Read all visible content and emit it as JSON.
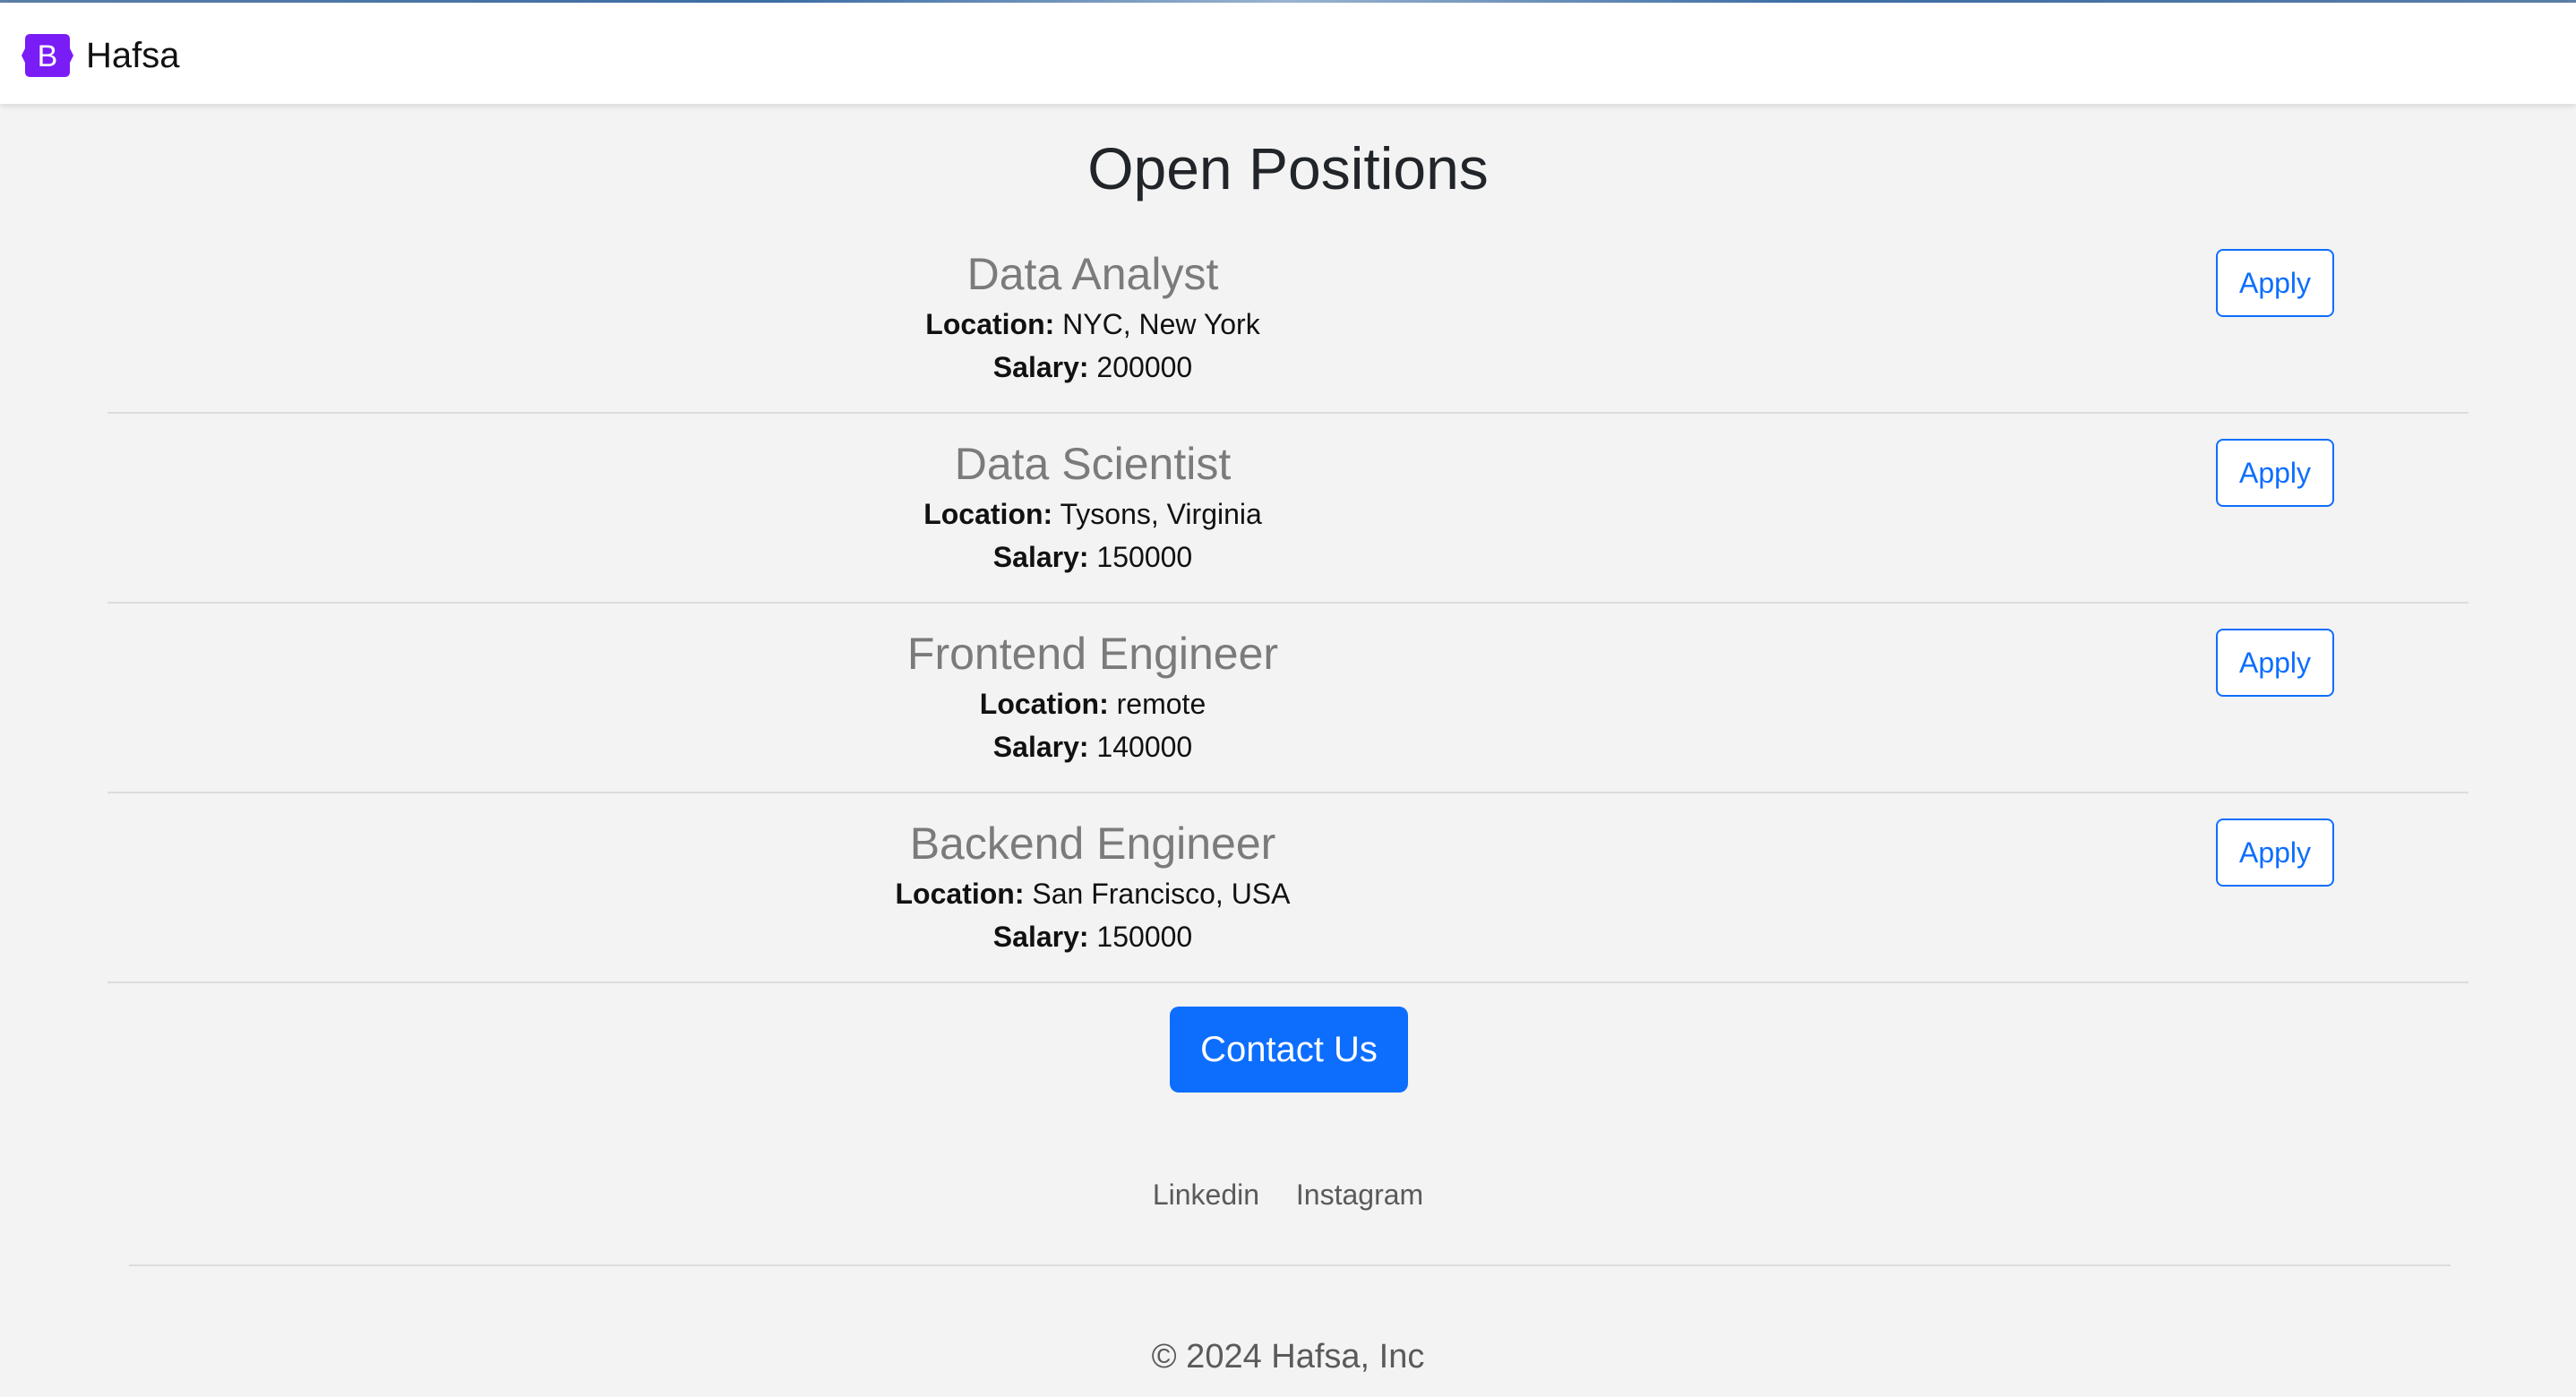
{
  "navbar": {
    "brand_letter": "B",
    "brand_name": "Hafsa",
    "brand_color": "#7a1cf6"
  },
  "page": {
    "title": "Open Positions"
  },
  "positions": [
    {
      "title": "Data Analyst",
      "location_label": "Location:",
      "location": "NYC, New York",
      "salary_label": "Salary:",
      "salary": "200000",
      "apply_label": "Apply"
    },
    {
      "title": "Data Scientist",
      "location_label": "Location:",
      "location": "Tysons, Virginia",
      "salary_label": "Salary:",
      "salary": "150000",
      "apply_label": "Apply"
    },
    {
      "title": "Frontend Engineer",
      "location_label": "Location:",
      "location": "remote",
      "salary_label": "Salary:",
      "salary": "140000",
      "apply_label": "Apply"
    },
    {
      "title": "Backend Engineer",
      "location_label": "Location:",
      "location": "San Francisco, USA",
      "salary_label": "Salary:",
      "salary": "150000",
      "apply_label": "Apply"
    }
  ],
  "contact": {
    "button_label": "Contact Us",
    "color": "#0d6efd"
  },
  "footer": {
    "links": [
      "Linkedin",
      "Instagram"
    ],
    "copyright": "© 2024 Hafsa, Inc"
  }
}
